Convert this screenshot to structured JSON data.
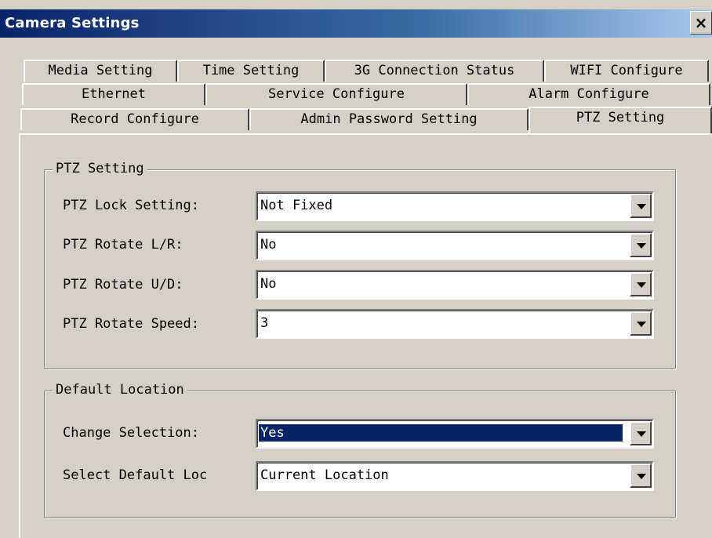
{
  "window": {
    "title": "Camera Settings",
    "close_glyph": "×"
  },
  "tabs": {
    "row1": [
      {
        "label": "Media Setting"
      },
      {
        "label": "Time Setting"
      },
      {
        "label": "3G Connection Status"
      },
      {
        "label": "WIFI Configure"
      }
    ],
    "row2": [
      {
        "label": "Ethernet"
      },
      {
        "label": "Service Configure"
      },
      {
        "label": "Alarm Configure"
      }
    ],
    "row3": [
      {
        "label": "Record Configure"
      },
      {
        "label": "Admin Password Setting"
      },
      {
        "label": "PTZ Setting"
      }
    ],
    "active": "PTZ Setting"
  },
  "ptz_group": {
    "title": "PTZ Setting",
    "fields": [
      {
        "label": "PTZ Lock Setting:",
        "value": "Not Fixed"
      },
      {
        "label": "PTZ Rotate L/R:",
        "value": "No"
      },
      {
        "label": "PTZ Rotate U/D:",
        "value": "No"
      },
      {
        "label": "PTZ Rotate Speed:",
        "value": "3"
      }
    ]
  },
  "default_group": {
    "title": "Default Location",
    "fields": [
      {
        "label": "Change Selection:",
        "value": "Yes"
      },
      {
        "label": "Select Default Loc",
        "value": "Current Location"
      }
    ]
  },
  "colors": {
    "face": "#d4d0c8",
    "title_start": "#0a246a",
    "title_end": "#a6caf0",
    "selection": "#0a246a"
  },
  "icons": {
    "close": "close-icon",
    "dropdown": "chevron-down-icon"
  }
}
